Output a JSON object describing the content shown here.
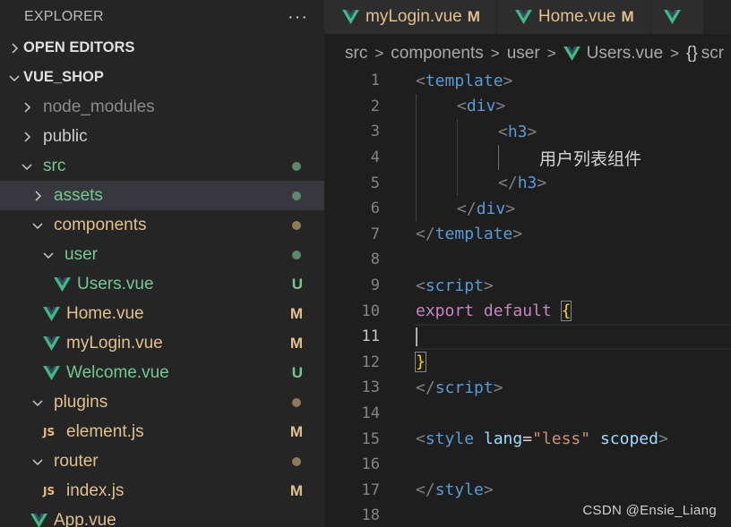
{
  "colors": {
    "vue_green": "#42b883",
    "modified": "#e2c08d",
    "untracked": "#73c991",
    "folder_text": "#e2c08d"
  },
  "sidebar": {
    "title": "EXPLORER",
    "more": "···",
    "open_editors": "OPEN EDITORS",
    "project": "VUE_SHOP",
    "items": [
      {
        "label": "node_modules",
        "status": "",
        "color": "#8c8c8c"
      },
      {
        "label": "public",
        "status": "",
        "color": "#cccccc"
      },
      {
        "label": "src",
        "status": "",
        "color": "#73c991"
      },
      {
        "label": "assets",
        "status": "",
        "color": "#73c991"
      },
      {
        "label": "components",
        "status": "",
        "color": "#e2c08d"
      },
      {
        "label": "user",
        "status": "",
        "color": "#73c991"
      },
      {
        "label": "Users.vue",
        "status": "U",
        "color": "#73c991"
      },
      {
        "label": "Home.vue",
        "status": "M",
        "color": "#e2c08d"
      },
      {
        "label": "myLogin.vue",
        "status": "M",
        "color": "#e2c08d"
      },
      {
        "label": "Welcome.vue",
        "status": "U",
        "color": "#73c991"
      },
      {
        "label": "plugins",
        "status": "",
        "color": "#e2c08d"
      },
      {
        "label": "element.js",
        "status": "M",
        "color": "#e2c08d"
      },
      {
        "label": "router",
        "status": "",
        "color": "#e2c08d"
      },
      {
        "label": "index.js",
        "status": "M",
        "color": "#e2c08d"
      },
      {
        "label": "App.vue",
        "status": "",
        "color": "#e2c08d"
      }
    ],
    "js_badge": "JS"
  },
  "tabs": [
    {
      "label": "myLogin.vue",
      "status": "M"
    },
    {
      "label": "Home.vue",
      "status": "M"
    }
  ],
  "breadcrumb": [
    "src",
    "components",
    "user",
    "Users.vue",
    "scr"
  ],
  "breadcrumb_braces": "{}",
  "code": {
    "line_numbers": [
      "1",
      "2",
      "3",
      "4",
      "5",
      "6",
      "7",
      "8",
      "9",
      "10",
      "11",
      "12",
      "13",
      "14",
      "15",
      "16",
      "17",
      "18"
    ],
    "current_line": 11,
    "l1": "template",
    "l2": "div",
    "l3": "h3",
    "l4": "用户列表组件",
    "l5": "h3",
    "l6": "div",
    "l7": "template",
    "l9": "script",
    "l10_kw1": "export",
    "l10_kw2": "default",
    "l10_brace": "{",
    "l12_brace": "}",
    "l13": "script",
    "l15_tag": "style",
    "l15_attr1": "lang",
    "l15_val": "\"less\"",
    "l15_attr2": "scoped",
    "l17": "style"
  },
  "watermark": "CSDN @Ensie_Liang"
}
